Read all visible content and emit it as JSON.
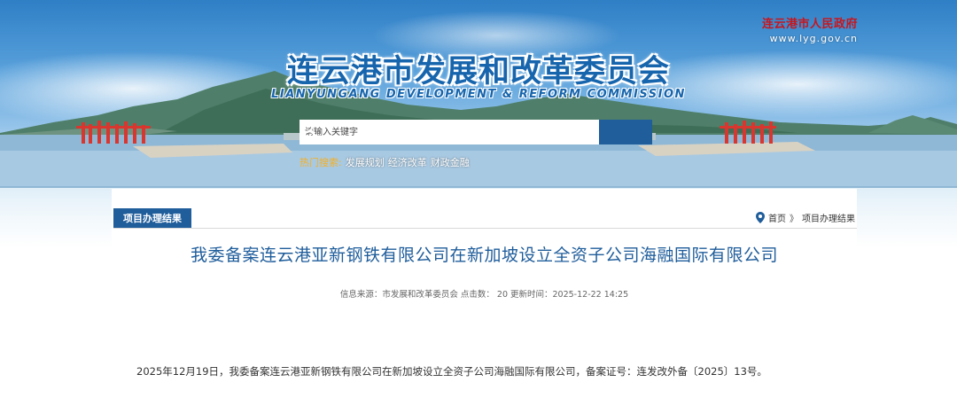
{
  "header": {
    "gov_name": "连云港市人民政府",
    "gov_url": "www.lyg.gov.cn",
    "title": "连云港市发展和改革委员会",
    "subtitle": "LIANYUNGANG DEVELOPMENT & REFORM COMMISSION"
  },
  "search": {
    "placeholder": "请输入关键字",
    "hot_label": "热门搜索:",
    "hot_terms": [
      "发展规划",
      "经济改革",
      "财政金融"
    ]
  },
  "section": {
    "tab_label": "项目办理结果"
  },
  "breadcrumb": {
    "home": "首页",
    "separator": "》",
    "current": "项目办理结果"
  },
  "article": {
    "title": "我委备案连云港亚新钢铁有限公司在新加坡设立全资子公司海融国际有限公司",
    "meta": "信息来源：市发展和改革委员会 点击数： 20 更新时间：2025-12-22 14:25",
    "body": "2025年12月19日，我委备案连云港亚新钢铁有限公司在新加坡设立全资子公司海融国际有限公司，备案证号：连发改外备〔2025〕13号。"
  },
  "colors": {
    "primary_blue": "#1f5d9b",
    "title_blue": "#1765ad",
    "gov_red": "#c8161d",
    "hot_orange": "#f5b025"
  }
}
